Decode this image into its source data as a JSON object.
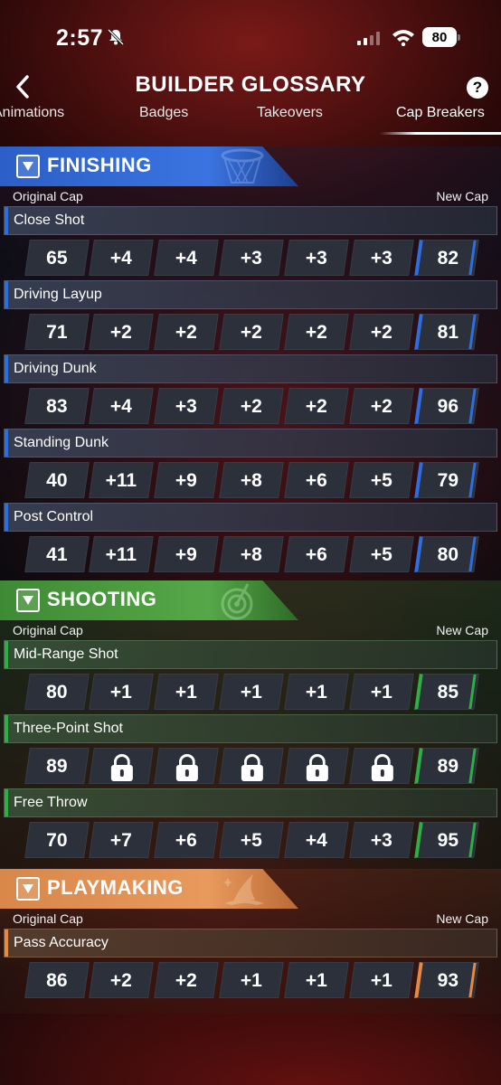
{
  "status_bar": {
    "time": "2:57",
    "battery": "80"
  },
  "header": {
    "title": "BUILDER GLOSSARY",
    "help": "?"
  },
  "tabs": [
    "Animations",
    "Badges",
    "Takeovers",
    "Cap Breakers"
  ],
  "active_tab": "Cap Breakers",
  "column_labels": {
    "original": "Original Cap",
    "new": "New Cap"
  },
  "sections": [
    {
      "title": "FINISHING",
      "accent": "#2d6fe0",
      "stats": [
        {
          "name": "Close Shot",
          "original": "65",
          "boosts": [
            "+4",
            "+4",
            "+3",
            "+3",
            "+3"
          ],
          "new": "82"
        },
        {
          "name": "Driving Layup",
          "original": "71",
          "boosts": [
            "+2",
            "+2",
            "+2",
            "+2",
            "+2"
          ],
          "new": "81"
        },
        {
          "name": "Driving Dunk",
          "original": "83",
          "boosts": [
            "+4",
            "+3",
            "+2",
            "+2",
            "+2"
          ],
          "new": "96"
        },
        {
          "name": "Standing Dunk",
          "original": "40",
          "boosts": [
            "+11",
            "+9",
            "+8",
            "+6",
            "+5"
          ],
          "new": "79"
        },
        {
          "name": "Post Control",
          "original": "41",
          "boosts": [
            "+11",
            "+9",
            "+8",
            "+6",
            "+5"
          ],
          "new": "80"
        }
      ]
    },
    {
      "title": "SHOOTING",
      "accent": "#2fae45",
      "stats": [
        {
          "name": "Mid-Range Shot",
          "original": "80",
          "boosts": [
            "+1",
            "+1",
            "+1",
            "+1",
            "+1"
          ],
          "new": "85"
        },
        {
          "name": "Three-Point Shot",
          "original": "89",
          "boosts": [
            "lock",
            "lock",
            "lock",
            "lock",
            "lock"
          ],
          "new": "89"
        },
        {
          "name": "Free Throw",
          "original": "70",
          "boosts": [
            "+7",
            "+6",
            "+5",
            "+4",
            "+3"
          ],
          "new": "95"
        }
      ]
    },
    {
      "title": "PLAYMAKING",
      "accent": "#e58a45",
      "stats": [
        {
          "name": "Pass Accuracy",
          "original": "86",
          "boosts": [
            "+2",
            "+2",
            "+1",
            "+1",
            "+1"
          ],
          "new": "93"
        }
      ]
    }
  ]
}
